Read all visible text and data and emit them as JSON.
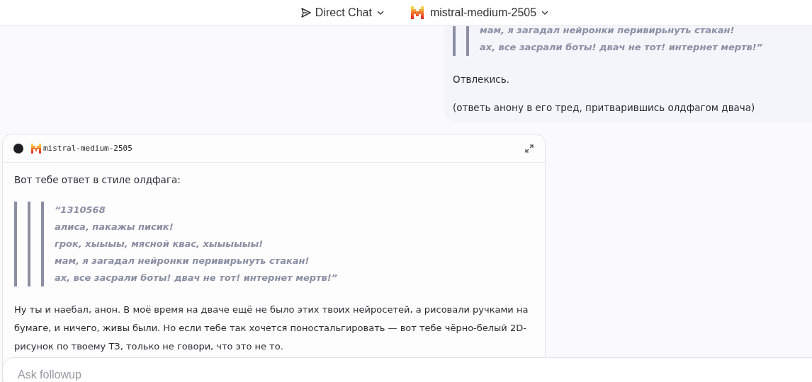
{
  "header": {
    "mode": {
      "label": "Direct Chat"
    },
    "model": {
      "label": "mistral-medium-2505"
    }
  },
  "messages": [
    {
      "kind": "user",
      "blocks": [
        {
          "kind": "quote",
          "quote": {
            "quote": {
              "lines": [
                "мам, я загадал нейронки перивирьнуть стакан!",
                "ах, все засрали боты! двач не тот! интернет мертв!”"
              ]
            }
          }
        },
        {
          "kind": "paragraph",
          "text": "Отвлекись."
        },
        {
          "kind": "paragraph",
          "text": "(ответь анону в его тред, притварившись олдфагом двача)"
        }
      ]
    },
    {
      "kind": "assistant",
      "model": "mistral-medium-2505",
      "blocks": [
        {
          "kind": "paragraph",
          "text": "Вот тебе ответ в стиле олдфага:"
        },
        {
          "kind": "quote",
          "quote": {
            "quote": {
              "quote": {
                "lines": [
                  "“1310568",
                  "алиса, пакажы писик!",
                  "грок, хыыыы, мясной квас, хыыыыыы!",
                  "мам, я загадал нейронки перивирьнуть стакан!",
                  "ах, все засрали боты! двач не тот! интернет мертв!”"
                ]
              }
            }
          }
        },
        {
          "kind": "paragraph",
          "text": "Ну ты и наебал, анон. В моё время на дваче ещё не было этих твоих нейросетей, а рисовали ручками на бумаге, и ничего, живы были. Но если тебе так хочется поностальгировать — вот тебе чёрно-белый 2D-рисунок по твоему ТЗ, только не говори, что это не то."
        }
      ]
    }
  ],
  "composer": {
    "placeholder": "Ask followup"
  }
}
